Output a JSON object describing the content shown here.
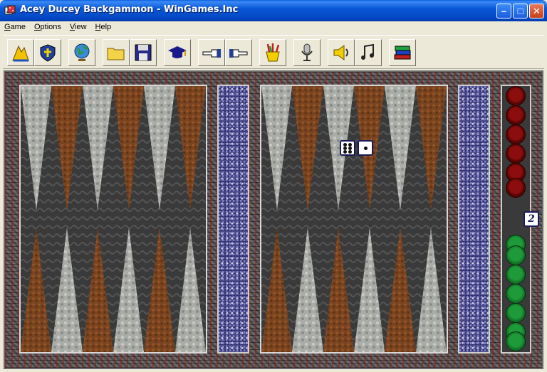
{
  "window": {
    "title": "Acey Ducey Backgammon - WinGames.Inc",
    "minimize_glyph": "–",
    "maximize_glyph": "□",
    "close_glyph": "✕"
  },
  "menu": [
    {
      "pre": "",
      "u": "G",
      "post": "ame"
    },
    {
      "pre": "",
      "u": "O",
      "post": "ptions"
    },
    {
      "pre": "",
      "u": "V",
      "post": "iew"
    },
    {
      "pre": "",
      "u": "H",
      "post": "elp"
    }
  ],
  "toolbar_icons": [
    "new-game-icon",
    "rules-shield-icon",
    "globe-icon",
    "open-folder-icon",
    "save-disk-icon",
    "graduation-cap-icon",
    "point-left-icon",
    "point-right-icon",
    "paint-tools-icon",
    "microphone-icon",
    "speaker-icon",
    "music-notes-icon",
    "books-icon"
  ],
  "dice": [
    6,
    1
  ],
  "doubling_cube": "2",
  "checkers": {
    "red_on_tray": 6,
    "green_on_tray": 7
  },
  "colors": {
    "red_checker": "#8c0d0d",
    "green_checker": "#1f9a3a",
    "brown_point": "#7a4420",
    "grey_point": "#aeb0ac",
    "dark_point": "#3b3b3b"
  }
}
